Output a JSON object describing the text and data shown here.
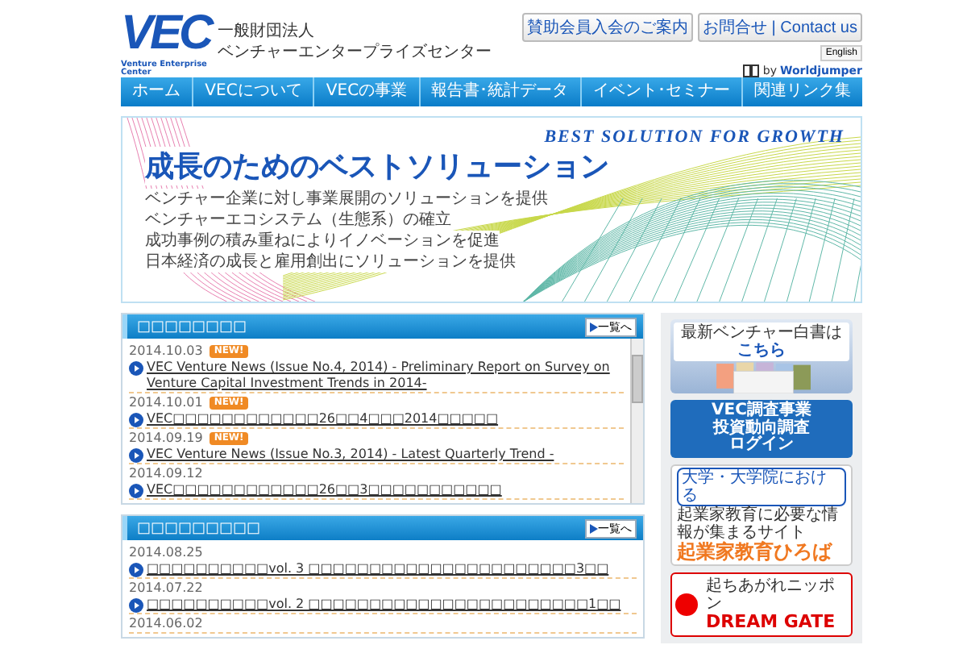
{
  "header": {
    "logo": "VEC",
    "logo_caption": "Venture Enterprise Center",
    "org_type": "一般財団法人",
    "org_name": "ベンチャーエンタープライズセンター",
    "buttons": [
      "賛助会員入会のご案内",
      "お問合せ | Contact us"
    ],
    "language_button": "English",
    "translator_by": "by",
    "translator": "Worldjumper"
  },
  "nav": [
    "ホーム",
    "VECについて",
    "VECの事業",
    "報告書･統計データ",
    "イベント･セミナー",
    "関連リンク集"
  ],
  "hero": {
    "tagline": "BEST SOLUTION FOR GROWTH",
    "title": "成長のためのベストソリューション",
    "lines": [
      "ベンチャー企業に対し事業展開のソリューションを提供",
      "ベンチャーエコシステム（生態系）の確立",
      "成功事例の積み重ねによりイノベーションを促進",
      "日本経済の成長と雇用創出にソリューションを提供"
    ]
  },
  "sections": [
    {
      "title": "□□□□□□□□",
      "more": "一覧へ",
      "scrollable": true,
      "items": [
        {
          "date": "2014.10.03",
          "badge": "NEW!",
          "text": "VEC Venture News (Issue No.4, 2014) - Preliminary Report on Survey on Venture Capital Investment Trends in 2014-"
        },
        {
          "date": "2014.10.01",
          "badge": "NEW!",
          "text": "VEC□□□□□□□□□□□□26□□4□□□2014□□□□□"
        },
        {
          "date": "2014.09.19",
          "badge": "NEW!",
          "text": "VEC Venture News (Issue No.3, 2014) - Latest Quarterly Trend -"
        },
        {
          "date": "2014.09.12",
          "text": "VEC□□□□□□□□□□□□26□□3□□□□□□□□□□□"
        }
      ]
    },
    {
      "title": "□□□□□□□□□",
      "more": "一覧へ",
      "items": [
        {
          "date": "2014.08.25",
          "text": "□□□□□□□□□□vol. 3 □□□□□□□□□□□□□□□□□□□□□□3□□"
        },
        {
          "date": "2014.07.22",
          "text": "□□□□□□□□□□vol. 2 □□□□□□□□□□□□□□□□□□□□□□□1□□"
        },
        {
          "date": "2014.06.02"
        }
      ]
    }
  ],
  "sidebar": [
    {
      "kind": "whitepaper",
      "lines": [
        "最新ベンチャー白書は",
        "こちら"
      ]
    },
    {
      "kind": "login",
      "lines": [
        "VEC調査事業",
        "投資動向調査",
        "ログイン"
      ]
    },
    {
      "kind": "education",
      "lines": [
        "大学・大学院における",
        "起業家教育に必要な情報が集まるサイト",
        "起業家教育ひろば"
      ]
    },
    {
      "kind": "dreamgate",
      "lines": [
        "起ちあがれニッポン",
        "DREAM GATE"
      ]
    }
  ]
}
